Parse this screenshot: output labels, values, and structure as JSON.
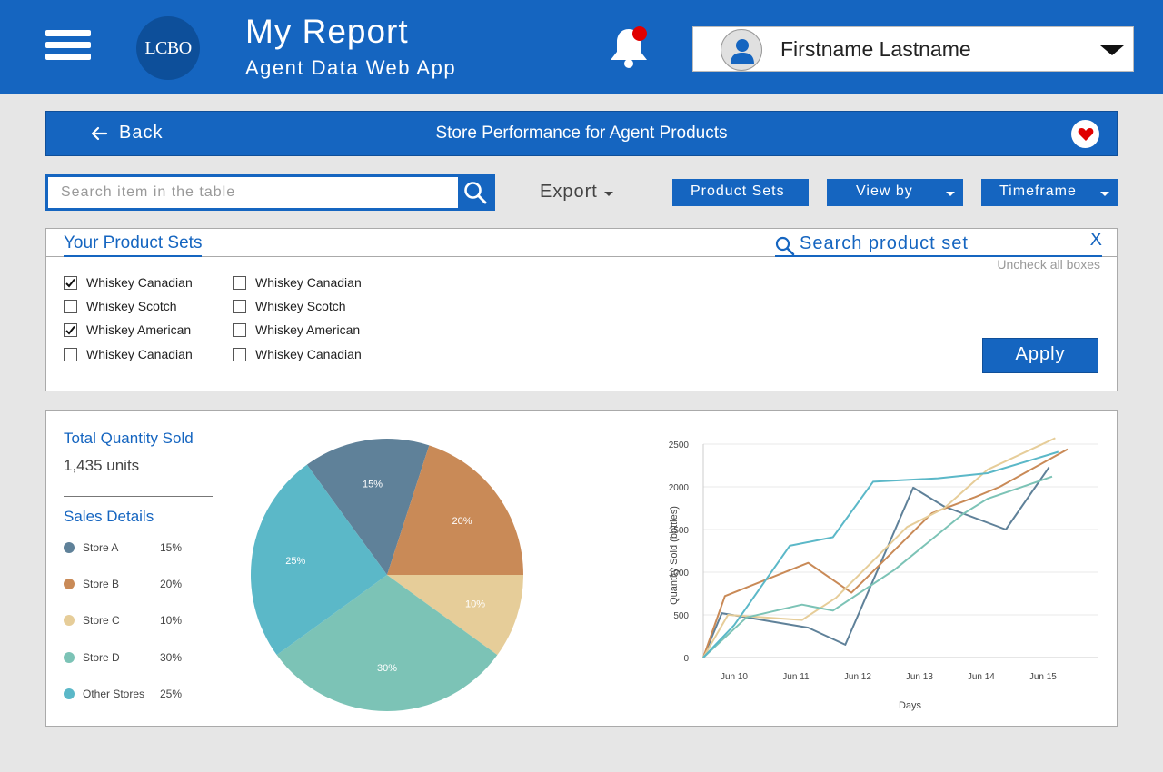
{
  "header": {
    "logo_text": "LCBO",
    "title": "My Report",
    "subtitle": "Agent Data Web App",
    "user_name": "Firstname Lastname",
    "brand_color": "#1565c0",
    "notification_dot_color": "#e00000"
  },
  "titlebar": {
    "back_label": "Back",
    "page_title": "Store Performance for Agent Products"
  },
  "toolbar": {
    "search_placeholder": "Search item in the table",
    "export_label": "Export",
    "product_sets_label": "Product Sets",
    "view_by_label": "View by",
    "timeframe_label": "Timeframe"
  },
  "product_sets": {
    "title": "Your Product Sets",
    "search_placeholder": "Search product set",
    "clear_label": "X",
    "uncheck_all_label": "Uncheck all boxes",
    "apply_label": "Apply",
    "columns": [
      [
        {
          "label": "Whiskey Canadian",
          "checked": true
        },
        {
          "label": "Whiskey Scotch",
          "checked": false
        },
        {
          "label": "Whiskey American",
          "checked": true
        },
        {
          "label": "Whiskey Canadian",
          "checked": false
        }
      ],
      [
        {
          "label": "Whiskey Canadian",
          "checked": false
        },
        {
          "label": "Whiskey Scotch",
          "checked": false
        },
        {
          "label": "Whiskey American",
          "checked": false
        },
        {
          "label": "Whiskey Canadian",
          "checked": false
        }
      ]
    ]
  },
  "summary": {
    "total_label": "Total Quantity Sold",
    "total_value": "1,435 units",
    "sales_details_label": "Sales Details",
    "legend": [
      {
        "name": "Store A",
        "pct": "15%",
        "color": "#5f8199"
      },
      {
        "name": "Store B",
        "pct": "20%",
        "color": "#c98a57"
      },
      {
        "name": "Store C",
        "pct": "10%",
        "color": "#e6cd99"
      },
      {
        "name": "Store D",
        "pct": "30%",
        "color": "#7cc3b6"
      },
      {
        "name": "Other Stores",
        "pct": "25%",
        "color": "#5bb8c8"
      }
    ]
  },
  "chart_data": [
    {
      "type": "pie",
      "categories": [
        "Store A",
        "Store B",
        "Store C",
        "Store D",
        "Other Stores"
      ],
      "values": [
        15,
        20,
        10,
        30,
        25
      ],
      "labels": [
        "15%",
        "20%",
        "10%",
        "30%",
        "25%"
      ],
      "colors": [
        "#5f8199",
        "#c98a57",
        "#e6cd99",
        "#7cc3b6",
        "#5bb8c8"
      ]
    },
    {
      "type": "line",
      "xlabel": "Days",
      "ylabel": "Quantity Sold (bottles)",
      "x": [
        "Jun 10",
        "Jun 11",
        "Jun 12",
        "Jun 13",
        "Jun 14",
        "Jun 15"
      ],
      "ylim": [
        0,
        2500
      ],
      "yticks": [
        0,
        500,
        1000,
        1500,
        2000,
        2500
      ],
      "grid": true,
      "series": [
        {
          "color": "#5f8199",
          "points": [
            [
              9.5,
              0
            ],
            [
              9.8,
              520
            ],
            [
              11.2,
              350
            ],
            [
              11.8,
              150
            ],
            [
              12.9,
              1990
            ],
            [
              13.4,
              1770
            ],
            [
              14.4,
              1500
            ],
            [
              15.1,
              2230
            ]
          ]
        },
        {
          "color": "#c98a57",
          "points": [
            [
              9.5,
              0
            ],
            [
              9.85,
              720
            ],
            [
              11.2,
              1110
            ],
            [
              11.9,
              760
            ],
            [
              13.2,
              1690
            ],
            [
              13.9,
              1880
            ],
            [
              14.3,
              2000
            ],
            [
              15.4,
              2440
            ]
          ]
        },
        {
          "color": "#e6cd99",
          "points": [
            [
              9.5,
              0
            ],
            [
              9.9,
              500
            ],
            [
              11.1,
              440
            ],
            [
              11.65,
              700
            ],
            [
              12.8,
              1530
            ],
            [
              13.4,
              1750
            ],
            [
              14.1,
              2200
            ],
            [
              15.2,
              2570
            ]
          ]
        },
        {
          "color": "#7cc3b6",
          "points": [
            [
              9.5,
              0
            ],
            [
              10.2,
              470
            ],
            [
              11.1,
              620
            ],
            [
              11.6,
              550
            ],
            [
              12.6,
              1030
            ],
            [
              13.7,
              1680
            ],
            [
              14.1,
              1860
            ],
            [
              15.15,
              2120
            ]
          ]
        },
        {
          "color": "#5bb8c8",
          "points": [
            [
              9.5,
              0
            ],
            [
              10.0,
              380
            ],
            [
              10.9,
              1310
            ],
            [
              11.6,
              1410
            ],
            [
              12.25,
              2060
            ],
            [
              13.3,
              2100
            ],
            [
              14.1,
              2160
            ],
            [
              15.25,
              2410
            ]
          ]
        }
      ]
    }
  ]
}
